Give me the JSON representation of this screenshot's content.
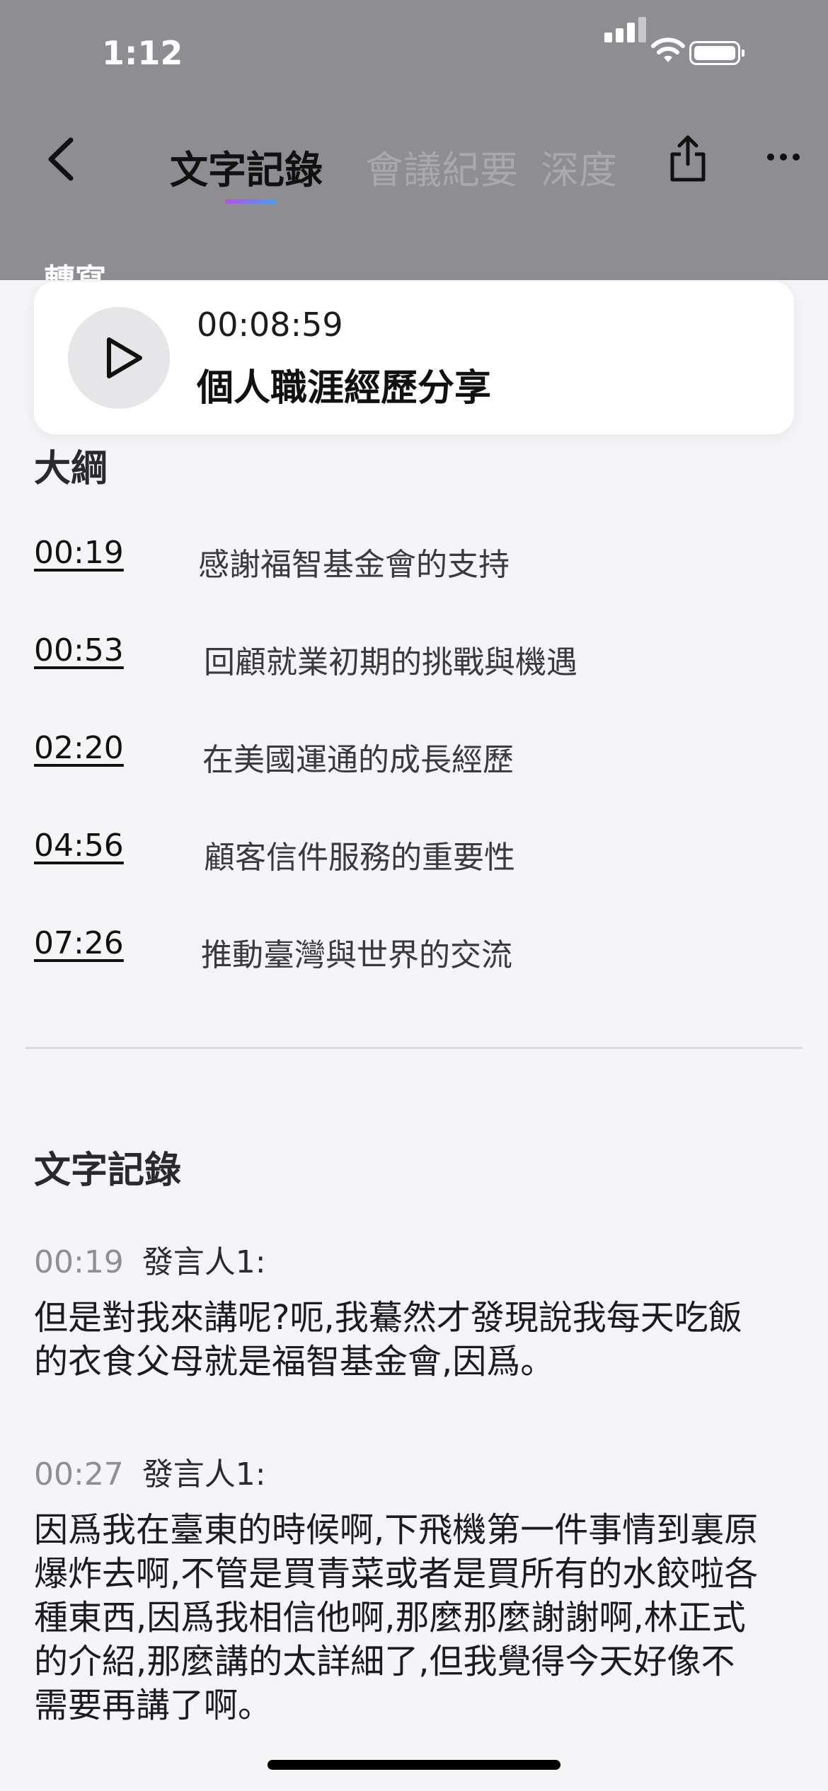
{
  "status_bar": {
    "time": "1:12"
  },
  "header": {
    "tabs": [
      "文字記錄",
      "會議紀要",
      "深度"
    ],
    "peek_label": "轉寫"
  },
  "player": {
    "time": "00:08:59",
    "title": "個人職涯經歷分享"
  },
  "outline": {
    "title": "大綱",
    "items": [
      {
        "time": "00:19",
        "text": "感謝福智基金會的支持"
      },
      {
        "time": "00:53",
        "text": "回顧就業初期的挑戰與機遇"
      },
      {
        "time": "02:20",
        "text": "在美國運通的成長經歷"
      },
      {
        "time": "04:56",
        "text": "顧客信件服務的重要性"
      },
      {
        "time": "07:26",
        "text": "推動臺灣與世界的交流"
      }
    ]
  },
  "transcript": {
    "title": "文字記錄",
    "entries": [
      {
        "time": "00:19",
        "speaker": "發言人1:",
        "lines": [
          "但是對我來講呢?呃,我驀然才發現說我每天吃飯",
          "的衣食父母就是福智基金會,因爲。"
        ]
      },
      {
        "time": "00:27",
        "speaker": "發言人1:",
        "lines": [
          "因爲我在臺東的時候啊,下飛機第一件事情到裏原",
          "爆炸去啊,不管是買青菜或者是買所有的水餃啦各",
          "種東西,因爲我相信他啊,那麼那麼謝謝啊,林正式",
          "的介紹,那麼講的太詳細了,但我覺得今天好像不",
          "需要再講了啊。"
        ]
      }
    ]
  }
}
